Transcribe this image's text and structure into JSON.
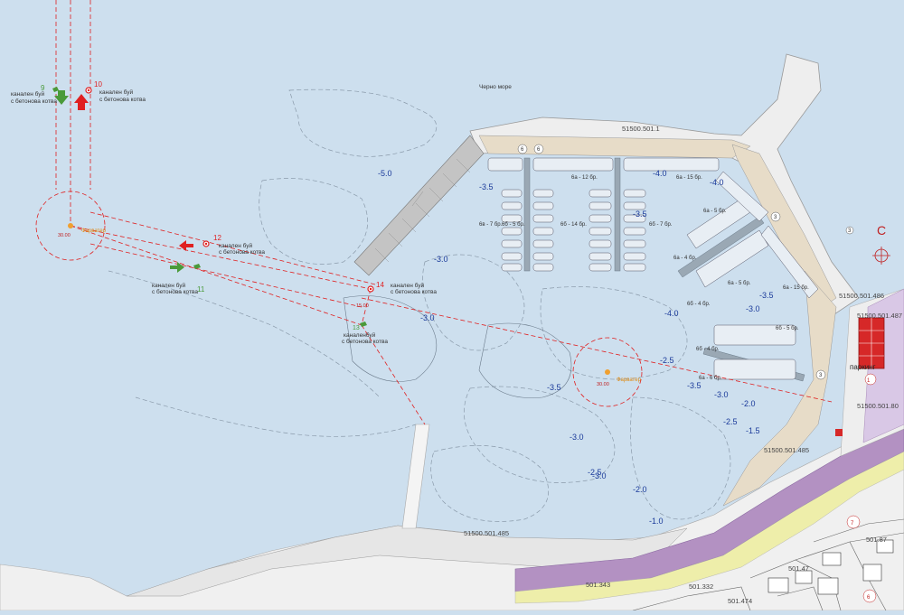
{
  "buoys": [
    {
      "num": "9",
      "text1": "канален буй",
      "text2": "с бетонова котва"
    },
    {
      "num": "10",
      "text1": "канален буй",
      "text2": "с бетонова котва"
    },
    {
      "num": "12",
      "text1": "канален буй",
      "text2": "с бетонова котва"
    },
    {
      "num": "11",
      "text1": "канален буй",
      "text2": "с бетонова котва"
    },
    {
      "num": "14",
      "text1": "канален буй",
      "text2": "с бетонова котва"
    },
    {
      "num": "13",
      "text1": "каналенбуй",
      "text2": "с бетонова котва"
    }
  ],
  "turning_circles": [
    {
      "dim": "30.00",
      "label": "Фарватер"
    },
    {
      "dim": "30.00",
      "label": "Фарватер"
    }
  ],
  "channel": {
    "width": "15.00"
  },
  "sea_label": "Черно море",
  "depths": [
    "-5.0",
    "-3.5",
    "-3.0",
    "-4.0",
    "-3.5",
    "-4.0",
    "-3.0",
    "-4.0",
    "-3.5",
    "-3.0",
    "-2.5",
    "-3.0",
    "-2.0",
    "-2.5",
    "-3.5",
    "-3.0",
    "-2.5",
    "-2.0",
    "-1.0",
    "-1.5",
    "-3.5",
    "-3.0"
  ],
  "berths": [
    "6а - 12 бр.",
    "6а - 15 бр.",
    "6б - 5 бр.",
    "6б - 14 бр.",
    "6в - 7 бр.",
    "6б - 7 бр.",
    "6а - 5 бр.",
    "6а - 4 бр.",
    "6а - 5 бр.",
    "6б - 4 бр.",
    "6а - 15 бр.",
    "6б - 4 бр.",
    "6б - 5 бр.",
    "6а - 6 бр."
  ],
  "parcels": [
    "51500.501.1",
    "51500.501.485",
    "51500.501.486",
    "51500.501.485",
    "51500.501.487",
    "51500.501.80",
    "501.343",
    "501.332",
    "501.474",
    "501.47",
    "501.87"
  ],
  "circle_nums": [
    "6",
    "6",
    "7",
    "6",
    "3",
    "3",
    "3",
    "1"
  ],
  "parking_label": "паркинг",
  "north_label": "С",
  "colors": {
    "sea": "#cddfee",
    "land": "#eeeeee",
    "pier": "#b8b8b8",
    "promenade": "#e7dcc8",
    "road": "#b391c2",
    "parking": "#d62828",
    "buoy_red": "#e02020",
    "buoy_green": "#4a9a3a",
    "depth": "#1a3a9a"
  }
}
